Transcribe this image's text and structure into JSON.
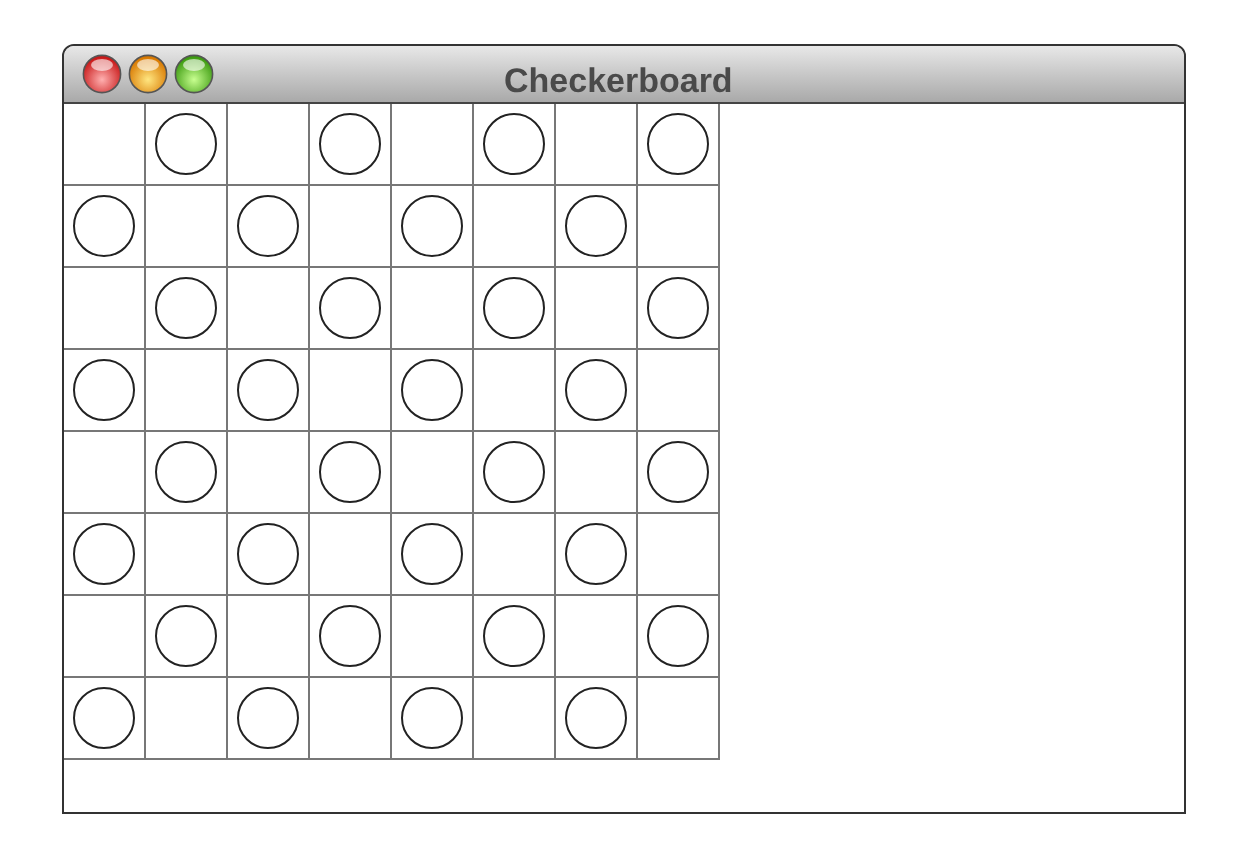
{
  "window": {
    "title": "Checkerboard"
  },
  "board": {
    "rows": [
      {
        "cells": [
          {
            "piece": false
          },
          {
            "piece": true
          },
          {
            "piece": false
          },
          {
            "piece": true
          },
          {
            "piece": false
          },
          {
            "piece": true
          },
          {
            "piece": false
          },
          {
            "piece": true
          }
        ]
      },
      {
        "cells": [
          {
            "piece": true
          },
          {
            "piece": false
          },
          {
            "piece": true
          },
          {
            "piece": false
          },
          {
            "piece": true
          },
          {
            "piece": false
          },
          {
            "piece": true
          },
          {
            "piece": false
          }
        ]
      },
      {
        "cells": [
          {
            "piece": false
          },
          {
            "piece": true
          },
          {
            "piece": false
          },
          {
            "piece": true
          },
          {
            "piece": false
          },
          {
            "piece": true
          },
          {
            "piece": false
          },
          {
            "piece": true
          }
        ]
      },
      {
        "cells": [
          {
            "piece": true
          },
          {
            "piece": false
          },
          {
            "piece": true
          },
          {
            "piece": false
          },
          {
            "piece": true
          },
          {
            "piece": false
          },
          {
            "piece": true
          },
          {
            "piece": false
          }
        ]
      },
      {
        "cells": [
          {
            "piece": false
          },
          {
            "piece": true
          },
          {
            "piece": false
          },
          {
            "piece": true
          },
          {
            "piece": false
          },
          {
            "piece": true
          },
          {
            "piece": false
          },
          {
            "piece": true
          }
        ]
      },
      {
        "cells": [
          {
            "piece": true
          },
          {
            "piece": false
          },
          {
            "piece": true
          },
          {
            "piece": false
          },
          {
            "piece": true
          },
          {
            "piece": false
          },
          {
            "piece": true
          },
          {
            "piece": false
          }
        ]
      },
      {
        "cells": [
          {
            "piece": false
          },
          {
            "piece": true
          },
          {
            "piece": false
          },
          {
            "piece": true
          },
          {
            "piece": false
          },
          {
            "piece": true
          },
          {
            "piece": false
          },
          {
            "piece": true
          }
        ]
      },
      {
        "cells": [
          {
            "piece": true
          },
          {
            "piece": false
          },
          {
            "piece": true
          },
          {
            "piece": false
          },
          {
            "piece": true
          },
          {
            "piece": false
          },
          {
            "piece": true
          },
          {
            "piece": false
          }
        ]
      }
    ]
  }
}
